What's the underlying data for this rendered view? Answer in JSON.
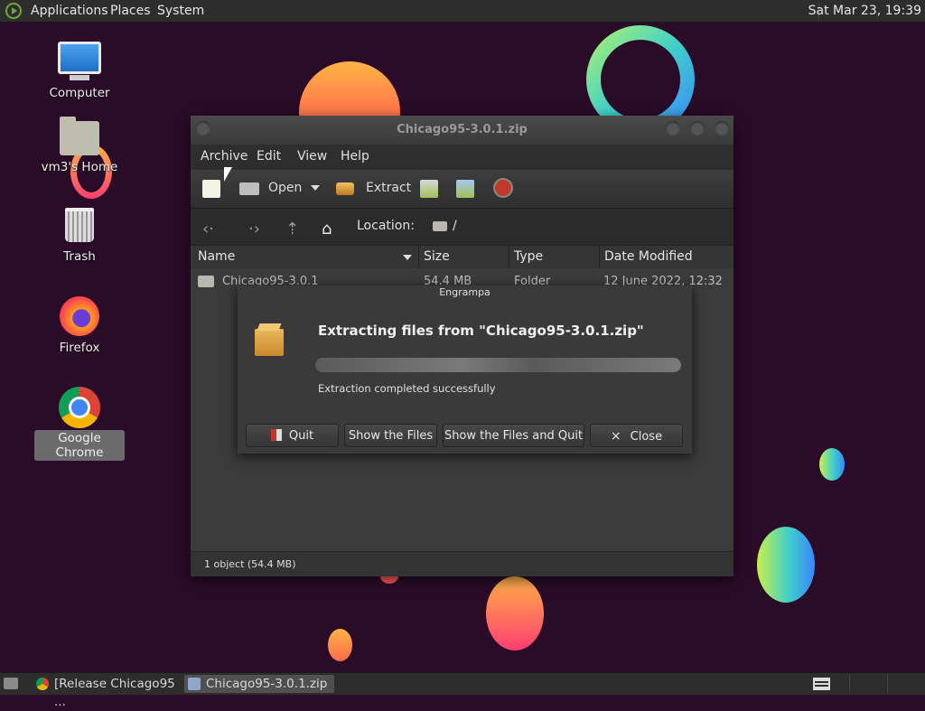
{
  "top_panel": {
    "menus": [
      "Applications",
      "Places",
      "System"
    ],
    "clock": "Sat Mar 23, 19:39"
  },
  "desktop_icons": [
    {
      "label": "Computer",
      "icon": "computer-icon"
    },
    {
      "label": "vm3's Home",
      "icon": "home-folder-icon"
    },
    {
      "label": "Trash",
      "icon": "trash-icon"
    },
    {
      "label": "Firefox",
      "icon": "firefox-icon"
    },
    {
      "label": "Google Chrome",
      "icon": "chrome-icon",
      "selected": true
    }
  ],
  "window": {
    "title": "Chicago95-3.0.1.zip",
    "menu": [
      "Archive",
      "Edit",
      "View",
      "Help"
    ],
    "toolbar": {
      "open_label": "Open",
      "extract_label": "Extract"
    },
    "location_label": "Location:",
    "location_path": "/",
    "columns": [
      "Name",
      "Size",
      "Type",
      "Date Modified"
    ],
    "rows": [
      {
        "name": "Chicago95-3.0.1",
        "size": "54.4 MB",
        "type": "Folder",
        "date": "12 June 2022, 12:32"
      }
    ],
    "status": "1 object (54.4 MB)"
  },
  "dialog": {
    "title": "Engrampa",
    "heading": "Extracting files from \"Chicago95-3.0.1.zip\"",
    "status": "Extraction completed successfully",
    "progress": 1.0,
    "buttons": {
      "quit": "Quit",
      "show_files": "Show the Files",
      "show_files_quit": "Show the Files and Quit",
      "close": "Close"
    }
  },
  "taskbar": {
    "tasks": [
      {
        "label": "[Release Chicago95 ...",
        "icon": "chrome-icon"
      },
      {
        "label": "Chicago95-3.0.1.zip",
        "icon": "archive-manager-icon",
        "active": true
      }
    ]
  }
}
